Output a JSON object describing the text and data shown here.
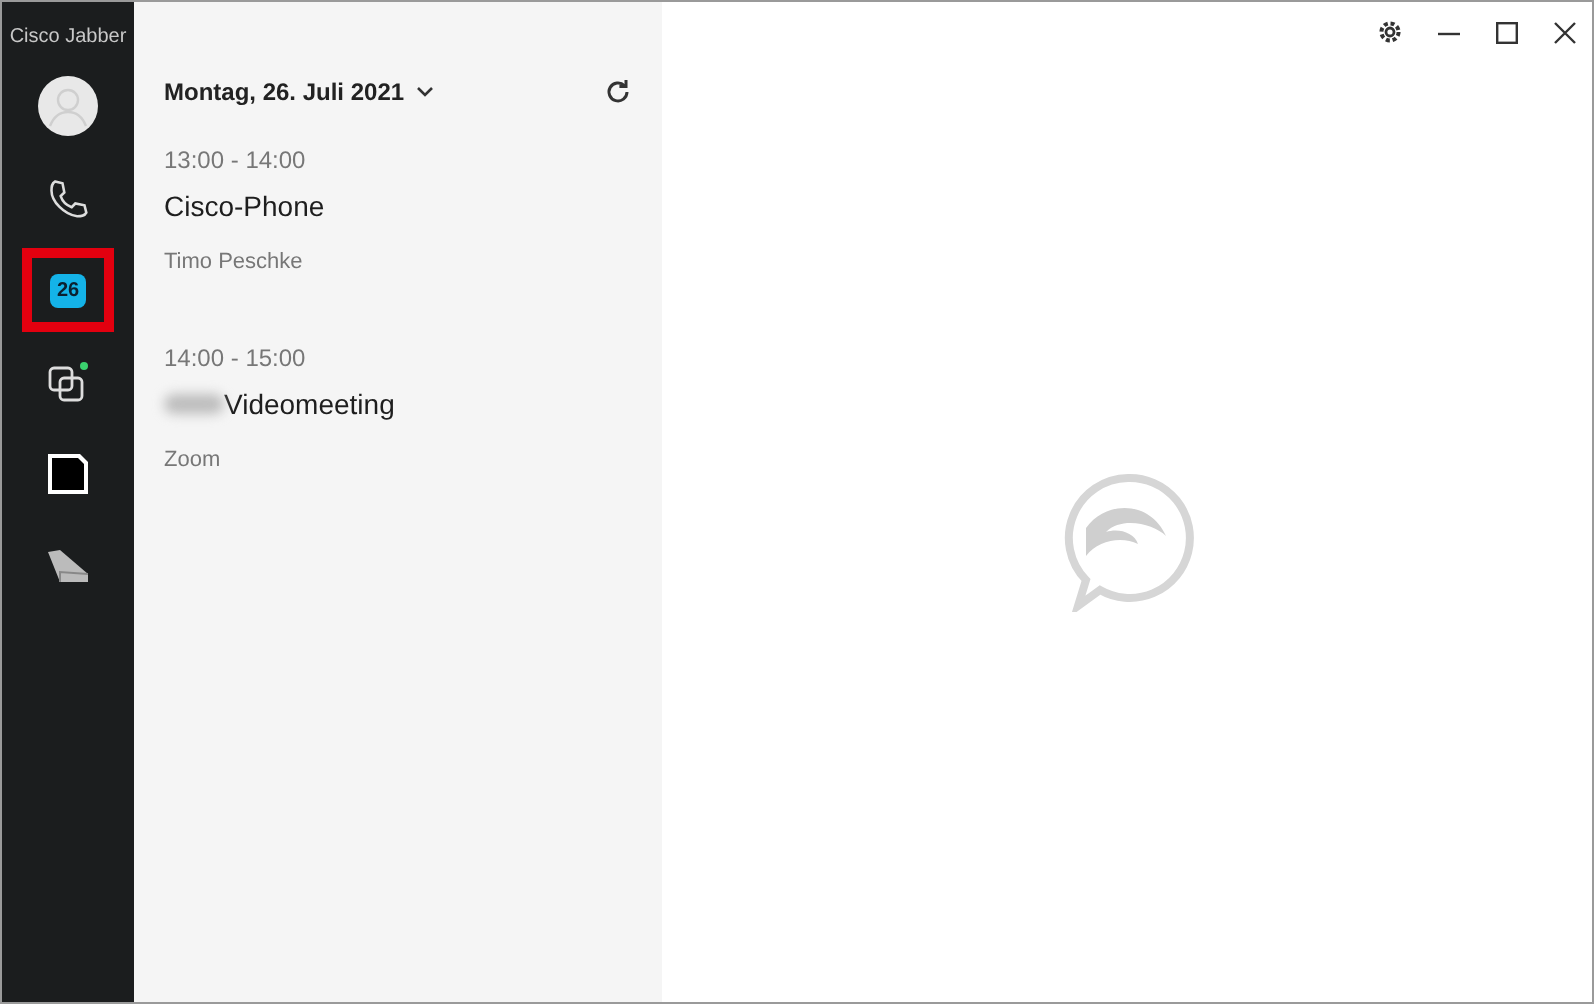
{
  "app": {
    "title": "Cisco Jabber"
  },
  "nav": [
    {
      "kind": "avatar",
      "highlighted": false
    },
    {
      "kind": "phone",
      "highlighted": false
    },
    {
      "kind": "calendar",
      "label": "26",
      "highlighted": true
    },
    {
      "kind": "chats",
      "highlighted": false
    },
    {
      "kind": "voicemail",
      "highlighted": false
    },
    {
      "kind": "meetings",
      "highlighted": false
    }
  ],
  "calendar": {
    "date": "Montag, 26. Juli 2021",
    "events": [
      {
        "time": "13:00 - 14:00",
        "title": "Cisco-Phone",
        "redacted": false,
        "subtitle": "Timo Peschke"
      },
      {
        "time": "14:00 - 15:00",
        "title": "Videomeeting",
        "redacted": true,
        "subtitle": "Zoom"
      }
    ]
  }
}
